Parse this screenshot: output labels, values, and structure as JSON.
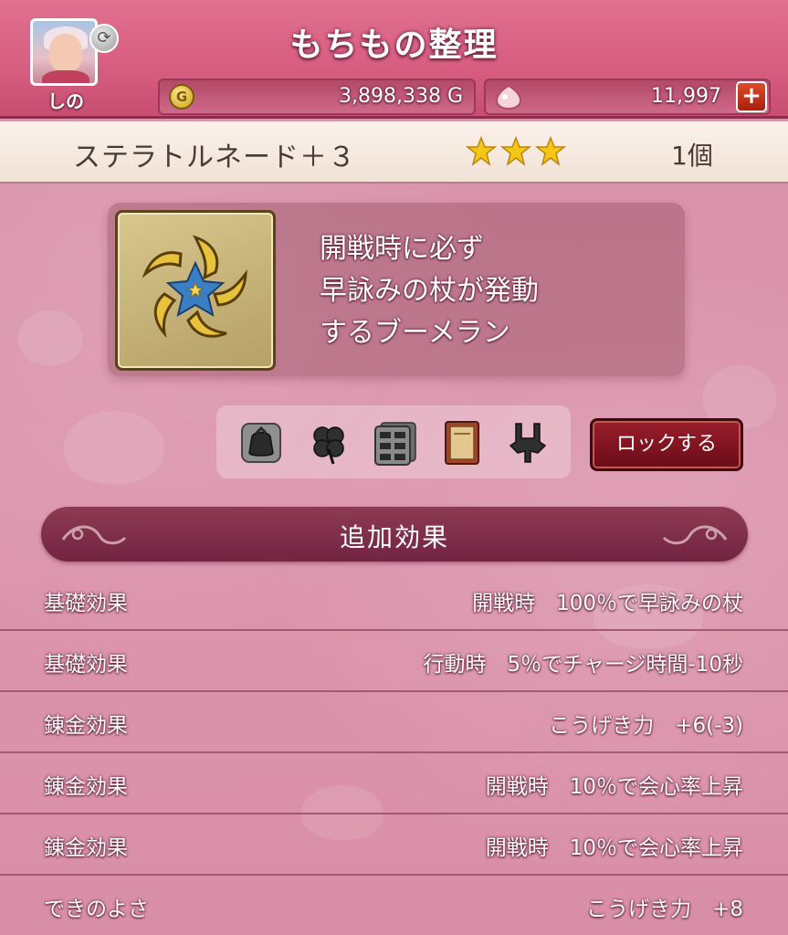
{
  "header": {
    "title": "もちもの整理",
    "player_name": "しの",
    "gold": "3,898,338 G",
    "gold_icon": "coin-icon",
    "gems": "11,997",
    "gem_icon": "gem-icon"
  },
  "item": {
    "name": "ステラトルネード＋３",
    "stars": 3,
    "count": "1個",
    "icon": "boomerang-star-icon",
    "description": [
      "開戦時に必ず",
      "早詠みの杖が発動",
      "するブーメラン"
    ]
  },
  "actions": {
    "icons": [
      "bag-recycle-icon",
      "clover-icon",
      "storage-cabinet-icon",
      "book-icon",
      "anvil-icon"
    ],
    "lock_label": "ロックする"
  },
  "section": {
    "title": "追加効果"
  },
  "effects": [
    {
      "label": "基礎効果",
      "value": "開戦時　100％で早詠みの杖"
    },
    {
      "label": "基礎効果",
      "value": "行動時　5％でチャージ時間-10秒"
    },
    {
      "label": "錬金効果",
      "value": "こうげき力　+6(-3)"
    },
    {
      "label": "錬金効果",
      "value": "開戦時　10％で会心率上昇"
    },
    {
      "label": "錬金効果",
      "value": "開戦時　10％で会心率上昇"
    },
    {
      "label": "できのよさ",
      "value": "こうげき力　+8"
    }
  ],
  "colors": {
    "header_bg": "#d85f82",
    "panel_bg": "#dc97ae",
    "lock_button": "#8a1524",
    "star": "#f5c518"
  }
}
